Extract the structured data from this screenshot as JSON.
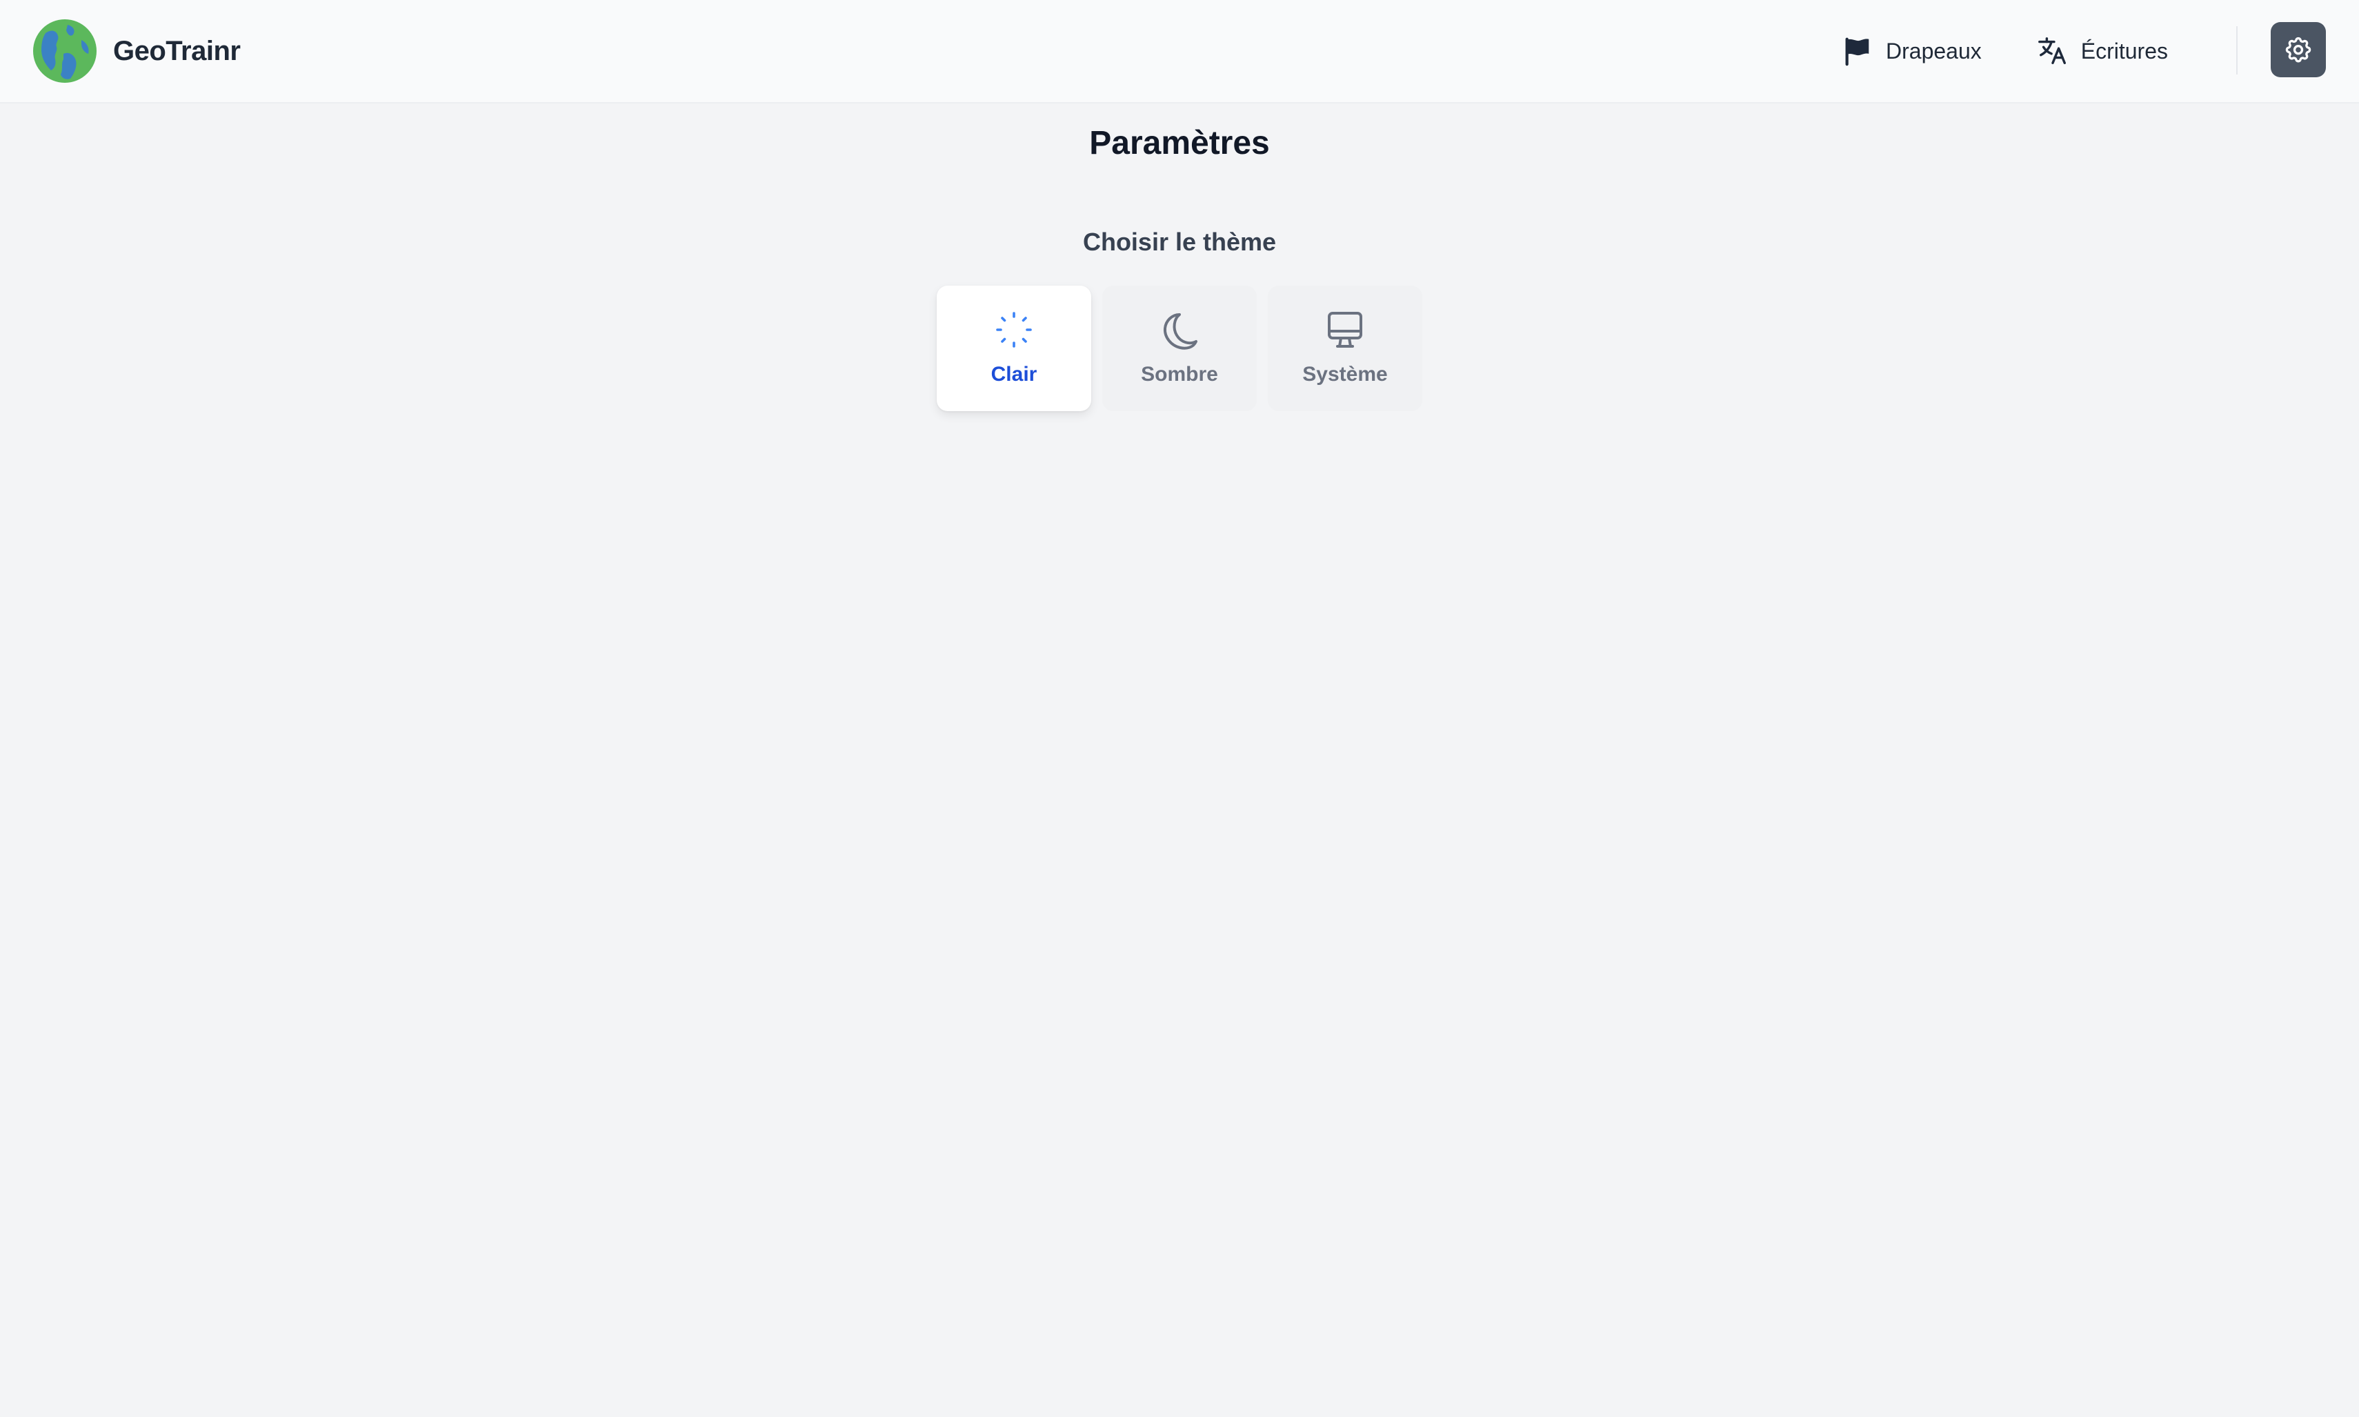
{
  "app": {
    "name": "GeoTrainr",
    "logo_icon": "globe-icon"
  },
  "nav": {
    "items": [
      {
        "label": "Drapeaux",
        "icon": "flag-icon"
      },
      {
        "label": "Écritures",
        "icon": "translate-icon"
      }
    ],
    "settings_icon": "gear-icon"
  },
  "page": {
    "title": "Paramètres",
    "theme_section": {
      "title": "Choisir le thème",
      "options": [
        {
          "label": "Clair",
          "icon": "sun-loading-icon",
          "selected": true
        },
        {
          "label": "Sombre",
          "icon": "moon-icon",
          "selected": false
        },
        {
          "label": "Système",
          "icon": "monitor-icon",
          "selected": false
        }
      ]
    }
  },
  "colors": {
    "accent": "#1d4ed8",
    "settings_button": "#4b5563",
    "background": "#f3f4f6",
    "header_background": "#f9fafb"
  }
}
